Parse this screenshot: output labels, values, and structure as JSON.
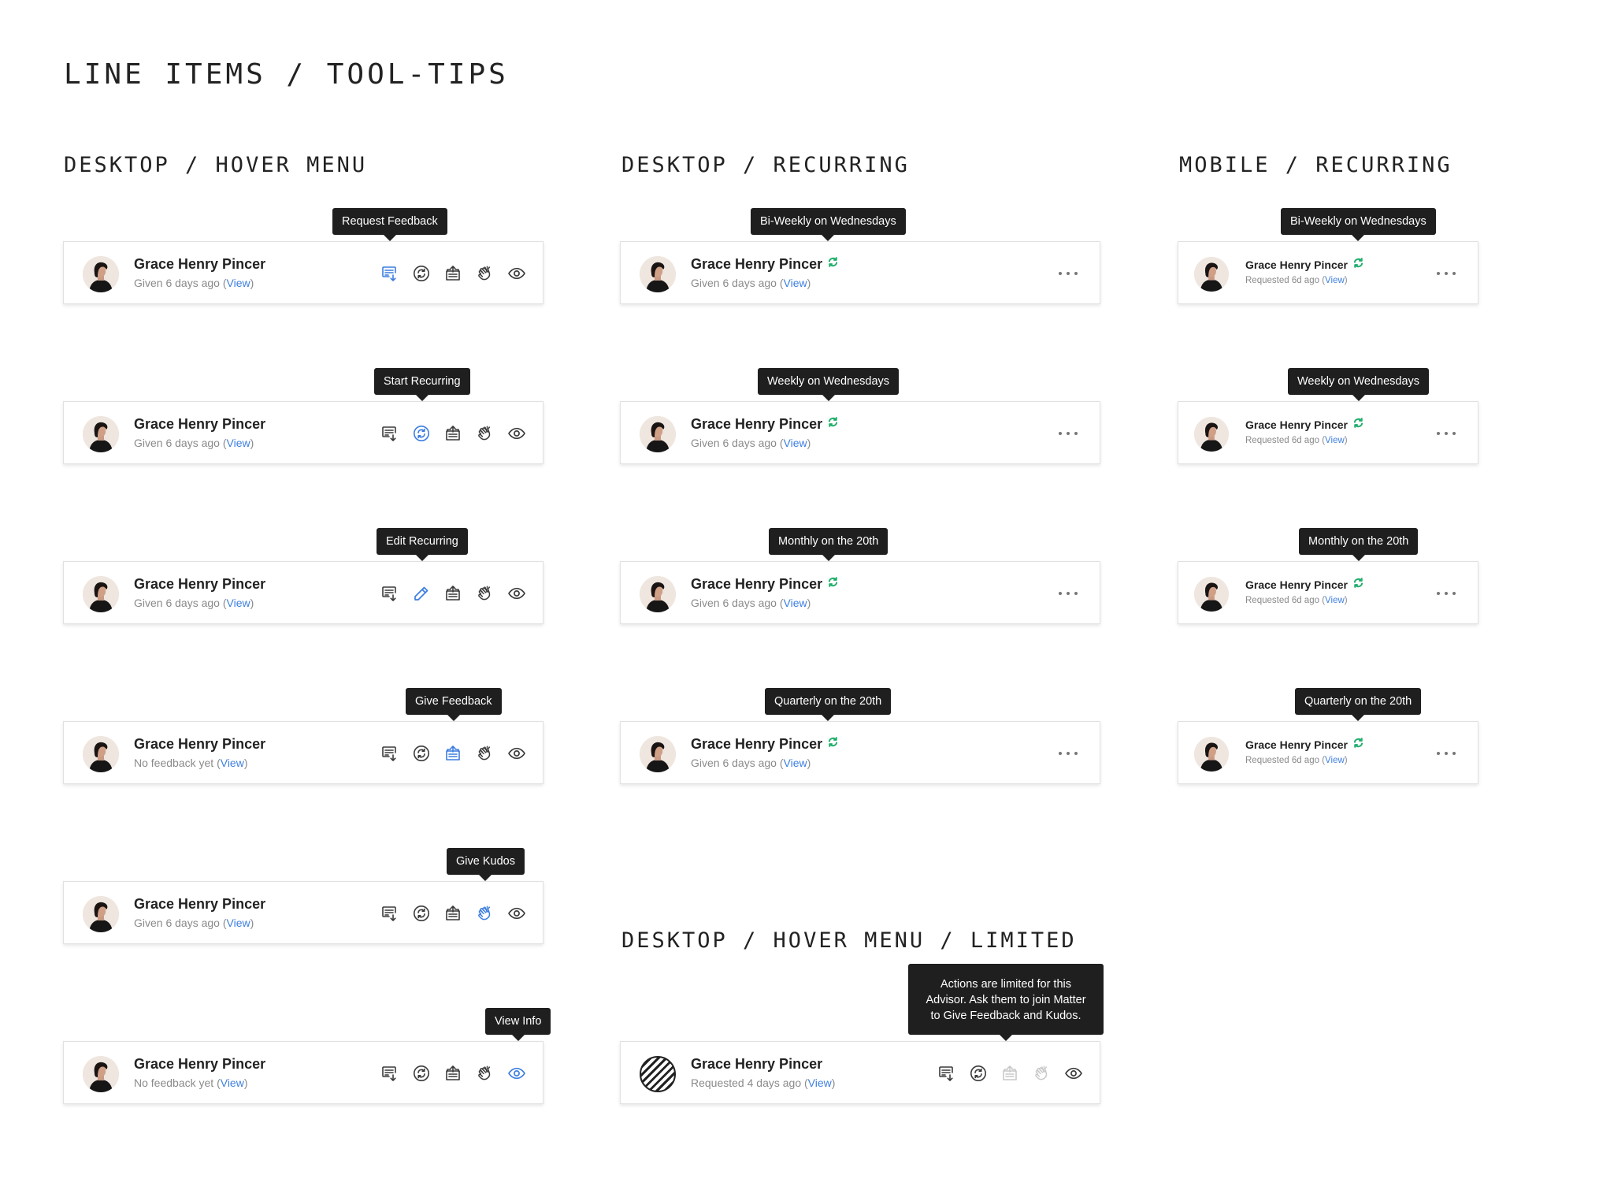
{
  "page_title": "LINE ITEMS / TOOL-TIPS",
  "sections": {
    "hover_menu": "DESKTOP / HOVER MENU",
    "desktop_recurring": "DESKTOP / RECURRING",
    "mobile_recurring": "MOBILE / RECURRING",
    "limited": "DESKTOP / HOVER MENU / LIMITED"
  },
  "person": {
    "name": "Grace Henry Pincer"
  },
  "link": {
    "open": "(",
    "label": "View",
    "close": ")"
  },
  "hover_rows": [
    {
      "status": "Given 6 days ago",
      "tooltip": "Request Feedback",
      "active": "request-feedback"
    },
    {
      "status": "Given 6 days ago",
      "tooltip": "Start Recurring",
      "active": "start-recurring"
    },
    {
      "status": "Given 6 days ago",
      "tooltip": "Edit Recurring",
      "active": "edit-recurring"
    },
    {
      "status": "No feedback yet",
      "tooltip": "Give Feedback",
      "active": "give-feedback"
    },
    {
      "status": "Given 6 days ago",
      "tooltip": "Give Kudos",
      "active": "give-kudos"
    },
    {
      "status": "No feedback yet",
      "tooltip": "View Info",
      "active": "view-info"
    }
  ],
  "desktop_recurring_rows": [
    {
      "status": "Given 6 days ago",
      "tooltip": "Bi-Weekly on Wednesdays"
    },
    {
      "status": "Given 6 days ago",
      "tooltip": "Weekly on Wednesdays"
    },
    {
      "status": "Given 6 days ago",
      "tooltip": "Monthly on the 20th"
    },
    {
      "status": "Given 6 days ago",
      "tooltip": "Quarterly on the 20th"
    }
  ],
  "mobile_recurring_rows": [
    {
      "status": "Requested 6d ago",
      "tooltip": "Bi-Weekly on Wednesdays"
    },
    {
      "status": "Requested 6d ago",
      "tooltip": "Weekly on Wednesdays"
    },
    {
      "status": "Requested 6d ago",
      "tooltip": "Monthly on the 20th"
    },
    {
      "status": "Requested 6d ago",
      "tooltip": "Quarterly on the 20th"
    }
  ],
  "limited_row": {
    "status": "Requested 4 days ago",
    "tooltip": "Actions are limited for this\nAdvisor. Ask them to join Matter\nto Give Feedback and Kudos."
  },
  "icons": [
    "request-feedback-icon",
    "recurring-icon",
    "give-feedback-icon",
    "kudos-clap-icon",
    "view-eye-icon",
    "more-dots-icon",
    "recurring-status-icon"
  ],
  "colors": {
    "accent_blue": "#3c7de0",
    "link_blue": "#3e7fe0",
    "recurring_green": "#1fae6b",
    "tooltip_bg": "#1f1f1f",
    "disabled_gray": "#c9c9c9"
  }
}
